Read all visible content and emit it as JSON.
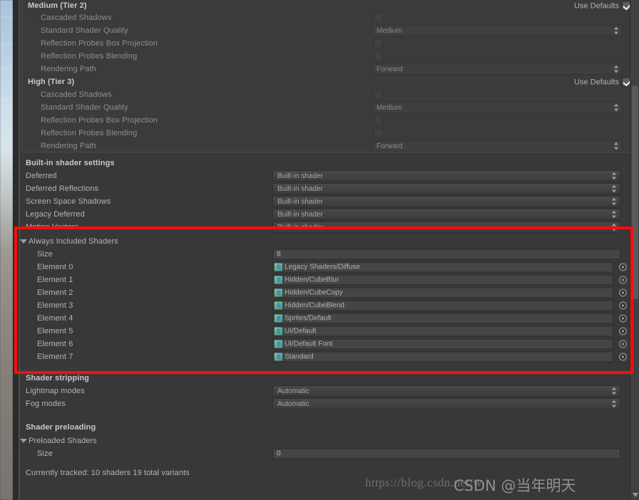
{
  "window": {
    "background": "#383838",
    "accent_annotation": "#fb0d0d"
  },
  "tiers": [
    {
      "name": "Medium (Tier 2)",
      "use_defaults_label": "Use Defaults",
      "use_defaults_checked": true,
      "settings": [
        {
          "label": "Cascaded Shadows",
          "control": "checkbox",
          "value": ""
        },
        {
          "label": "Standard Shader Quality",
          "control": "popup",
          "value": "Medium"
        },
        {
          "label": "Reflection Probes Box Projection",
          "control": "checkbox",
          "value": ""
        },
        {
          "label": "Reflection Probes Blending",
          "control": "checkbox",
          "value": ""
        },
        {
          "label": "Rendering Path",
          "control": "popup",
          "value": "Forward"
        }
      ]
    },
    {
      "name": "High (Tier 3)",
      "use_defaults_label": "Use Defaults",
      "use_defaults_checked": true,
      "settings": [
        {
          "label": "Cascaded Shadows",
          "control": "checkbox",
          "value": ""
        },
        {
          "label": "Standard Shader Quality",
          "control": "popup",
          "value": "Medium"
        },
        {
          "label": "Reflection Probes Box Projection",
          "control": "checkbox",
          "value": ""
        },
        {
          "label": "Reflection Probes Blending",
          "control": "checkbox",
          "value": ""
        },
        {
          "label": "Rendering Path",
          "control": "popup",
          "value": "Forward"
        }
      ]
    }
  ],
  "builtin_shader_settings": {
    "header": "Built-in shader settings",
    "rows": [
      {
        "label": "Deferred",
        "value": "Built-in shader"
      },
      {
        "label": "Deferred Reflections",
        "value": "Built-in shader"
      },
      {
        "label": "Screen Space Shadows",
        "value": "Built-in shader"
      },
      {
        "label": "Legacy Deferred",
        "value": "Built-in shader"
      },
      {
        "label": "Motion Vectors",
        "value": "Built-in shader"
      }
    ]
  },
  "always_included_shaders": {
    "header": "Always Included Shaders",
    "expanded": true,
    "size_label": "Size",
    "size_value": "8",
    "elements": [
      {
        "label": "Element 0",
        "value": "Legacy Shaders/Diffuse"
      },
      {
        "label": "Element 1",
        "value": "Hidden/CubeBlur"
      },
      {
        "label": "Element 2",
        "value": "Hidden/CubeCopy"
      },
      {
        "label": "Element 3",
        "value": "Hidden/CubeBlend"
      },
      {
        "label": "Element 4",
        "value": "Sprites/Default"
      },
      {
        "label": "Element 5",
        "value": "UI/Default"
      },
      {
        "label": "Element 6",
        "value": "UI/Default Font"
      },
      {
        "label": "Element 7",
        "value": "Standard"
      }
    ]
  },
  "shader_stripping": {
    "header": "Shader stripping",
    "rows": [
      {
        "label": "Lightmap modes",
        "value": "Automatic"
      },
      {
        "label": "Fog modes",
        "value": "Automatic"
      }
    ]
  },
  "shader_preloading": {
    "header": "Shader preloading",
    "preloaded_label": "Preloaded Shaders",
    "expanded": true,
    "size_label": "Size",
    "size_value": "0",
    "status": "Currently tracked: 10 shaders 19 total variants"
  },
  "watermarks": {
    "url": "https://blog.csdn.net/w",
    "csdn": "CSDN @当年明天"
  }
}
